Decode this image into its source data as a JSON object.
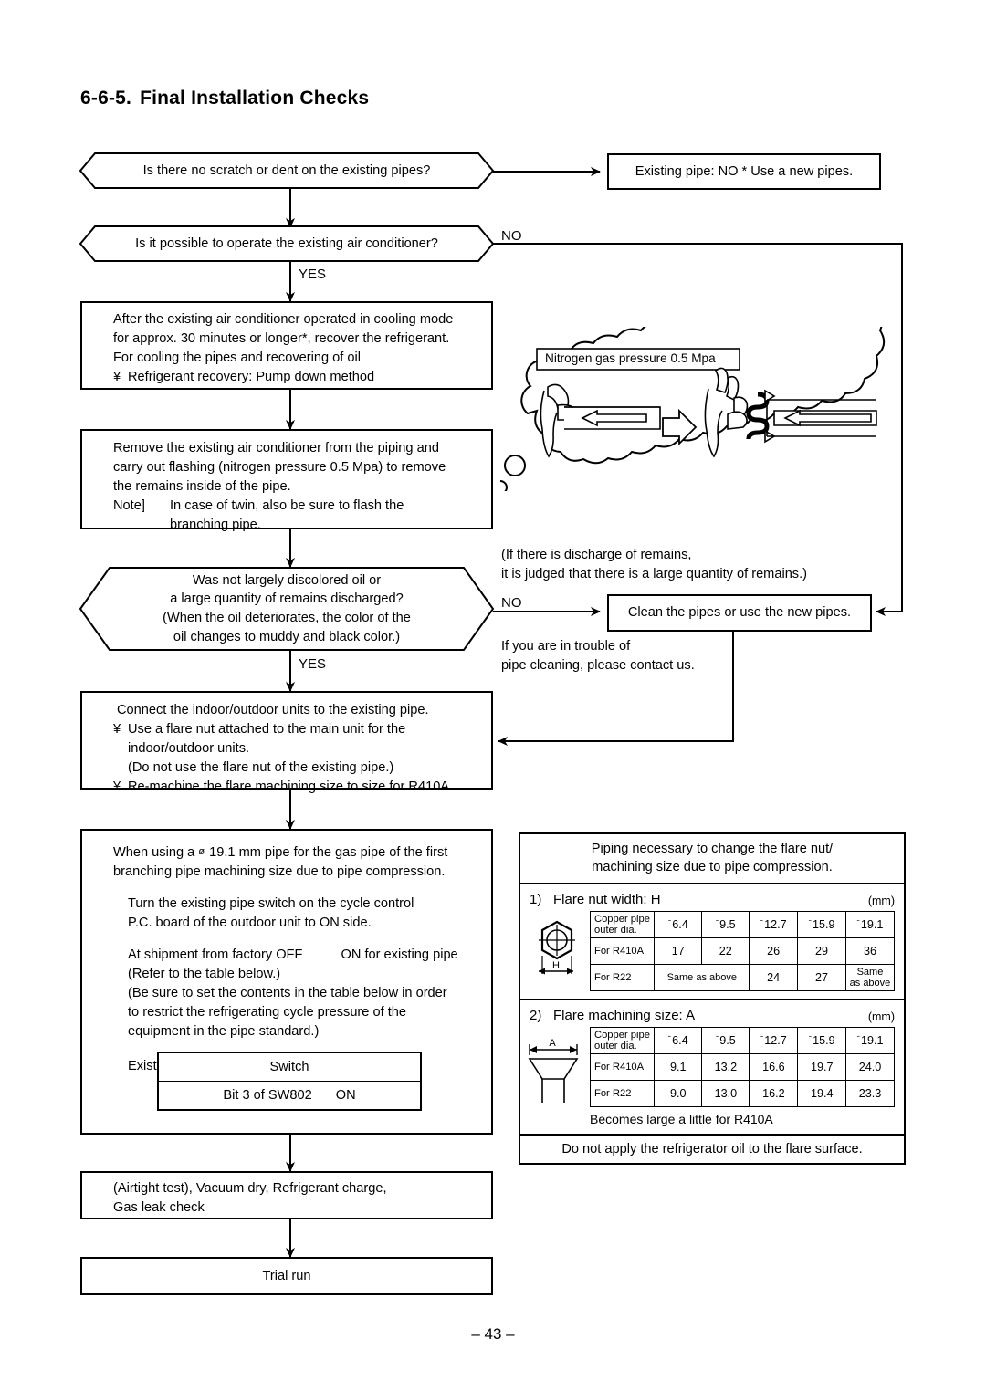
{
  "heading": {
    "number": "6-6-5.",
    "title": "Final Installation Checks"
  },
  "flow": {
    "d1": "Is there no scratch or dent on the existing pipes?",
    "b1": "Existing pipe: NO * Use a new pipes.",
    "d2": "Is it possible to operate the existing air conditioner?",
    "label_no_1": "NO",
    "label_yes_1": "YES",
    "b2": {
      "l1": "After the existing air conditioner operated in cooling mode",
      "l2": "for approx. 30 minutes or longer*, recover the refrigerant.",
      "l3": "For cooling the pipes and recovering of oil",
      "bullet": "¥",
      "l4": "Refrigerant recovery: Pump down method"
    },
    "b3": {
      "l1": "Remove the existing air conditioner from the piping and",
      "l2": "carry out flashing (nitrogen pressure 0.5 Mpa) to remove",
      "l3": "the remains inside of the pipe.",
      "note_label": "Note]",
      "l4": "In case of twin, also be sure to flash the",
      "l5": "branching pipe."
    },
    "d3": {
      "l1": "Was not largely discolored oil or",
      "l2": "a large quantity of remains discharged?",
      "l3": "(When the oil deteriorates, the color of the",
      "l4": "oil changes to muddy and black color.)"
    },
    "label_no_2": "NO",
    "label_yes_2": "YES",
    "side_note_1": "(If there is discharge of remains,\nit is judged that there is a large quantity of remains.)",
    "b4": "Clean the pipes or use the new pipes.",
    "side_note_2": "If you are in trouble of\npipe cleaning, please contact us.",
    "b5": {
      "l1": "Connect the indoor/outdoor units to the existing pipe.",
      "bullet": "¥",
      "l2": "Use a flare nut attached to the main unit for the",
      "l3": "indoor/outdoor units.",
      "l4": "(Do not use the flare nut of the existing pipe.)",
      "l5": "Re-machine the flare machining size to size for R410A."
    },
    "b6": {
      "l1_a": "When using a",
      "l1_dia": "ø",
      "l1_b": "19.1 mm pipe for the gas pipe of the first",
      "l2": "branching pipe machining size due to pipe compression.",
      "l3": "Turn the existing pipe switch on the cycle control",
      "l4": "P.C. board of the outdoor unit to ON side.",
      "l5_a": "At shipment from factory OFF",
      "l5_b": "ON for existing pipe",
      "l6": "(Refer to the table below.)",
      "l7": "(Be sure to set the contents in the table below in order",
      "l8": "to restrict the refrigerating cycle pressure of the",
      "l9": "equipment in the pipe standard.)",
      "sw_caption": "Existing pipe SW"
    },
    "sw_table": {
      "header": "Switch",
      "row_label": "Bit 3 of SW802",
      "row_value": "ON"
    },
    "b7": {
      "l1": "(Airtight test), Vacuum dry, Refrigerant charge,",
      "l2": "Gas leak check"
    },
    "b8": "Trial run"
  },
  "cloud": {
    "caption": "Nitrogen gas pressure 0.5 Mpa"
  },
  "right_panel": {
    "header_l1": "Piping necessary to change the flare nut/",
    "header_l2": "machining size due to pipe compression.",
    "footer": "Do not apply the refrigerator oil to the flare surface.",
    "unit": "(mm)",
    "table1": {
      "index": "1)",
      "title": "Flare nut width: H",
      "dim_label": "H",
      "row_head": "Copper pipe\nouter dia.",
      "diameters": [
        "6.4",
        "9.5",
        "12.7",
        "15.9",
        "19.1"
      ],
      "rows": [
        {
          "label": "For R410A",
          "values": [
            "17",
            "22",
            "26",
            "29",
            "36"
          ]
        },
        {
          "label": "For R22",
          "values": [
            "Same as above",
            "24",
            "27",
            "Same\nas above"
          ]
        }
      ]
    },
    "table2": {
      "index": "2)",
      "title": "Flare machining size: A",
      "dim_label": "A",
      "row_head": "Copper pipe\nouter dia.",
      "diameters": [
        "6.4",
        "9.5",
        "12.7",
        "15.9",
        "19.1"
      ],
      "rows": [
        {
          "label": "For R410A",
          "values": [
            "9.1",
            "13.2",
            "16.6",
            "19.7",
            "24.0"
          ]
        },
        {
          "label": "For R22",
          "values": [
            "9.0",
            "13.0",
            "16.2",
            "19.4",
            "23.3"
          ]
        }
      ],
      "note": "Becomes large a little for R410A"
    }
  },
  "page_number": "– 43 –"
}
